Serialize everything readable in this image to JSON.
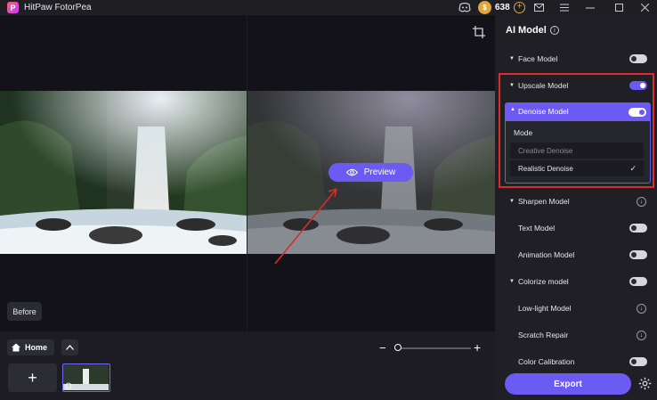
{
  "app": {
    "title": "HitPaw FotorPea",
    "logo_letter": "P"
  },
  "titlebar": {
    "coins": "638",
    "coin_symbol": "$",
    "add_symbol": "+"
  },
  "canvas": {
    "preview_label": "Preview",
    "before_label": "Before"
  },
  "bottom": {
    "home_label": "Home",
    "add_symbol": "+",
    "zoom_minus": "−",
    "zoom_plus": "+"
  },
  "panel": {
    "title": "AI Model",
    "info": "i",
    "models": {
      "face": "Face Model",
      "upscale": "Upscale Model",
      "denoise": "Denoise Model",
      "sharpen": "Sharpen Model",
      "text": "Text Model",
      "animation": "Animation Model",
      "colorize": "Colorize model",
      "lowlight": "Low-light Model",
      "scratch": "Scratch Repair",
      "calibration": "Color Calibration"
    },
    "mode_label": "Mode",
    "mode_options": [
      "Creative Denoise",
      "Realistic Denoise"
    ],
    "selected_mode": "Realistic Denoise",
    "export_label": "Export"
  },
  "colors": {
    "accent": "#6b5bf2",
    "highlight_box": "#d92c2c",
    "coin": "#e0a73a"
  }
}
